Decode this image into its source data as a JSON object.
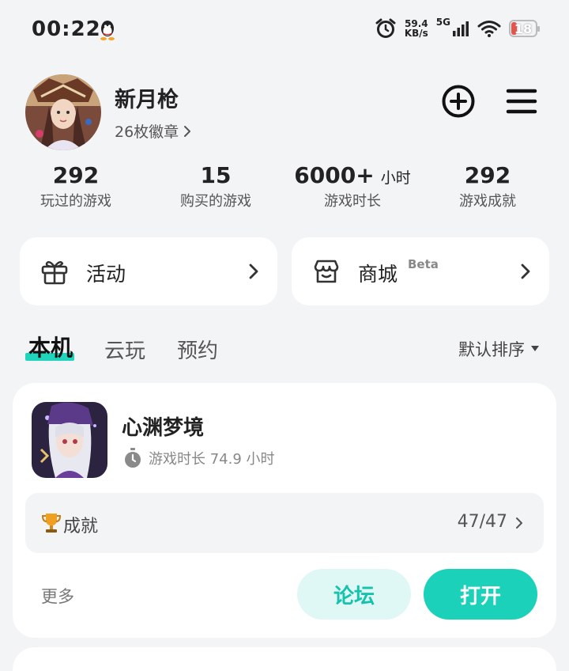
{
  "status_bar": {
    "time": "00:22",
    "net_speed_value": "59.4",
    "net_speed_unit": "KB/s",
    "network_type": "5G",
    "battery_level": "18",
    "icons": [
      "qq-icon",
      "alarm-clock-icon",
      "signal-icon",
      "wifi-icon",
      "battery-icon"
    ]
  },
  "profile": {
    "username": "新月枪",
    "badges_label": "26枚徽章",
    "actions": [
      "add-circle-icon",
      "menu-icon"
    ]
  },
  "stats": [
    {
      "value": "292",
      "unit": "",
      "label": "玩过的游戏"
    },
    {
      "value": "15",
      "unit": "",
      "label": "购买的游戏"
    },
    {
      "value": "6000+",
      "unit": "小时",
      "label": "游戏时长"
    },
    {
      "value": "292",
      "unit": "",
      "label": "游戏成就"
    }
  ],
  "quick_links": {
    "activity": {
      "label": "活动",
      "icon": "gift-icon"
    },
    "store": {
      "label": "商城",
      "tag": "Beta",
      "icon": "store-icon"
    }
  },
  "tabs": {
    "items": [
      "本机",
      "云玩",
      "预约"
    ],
    "active_index": 0,
    "sort_label": "默认排序"
  },
  "game": {
    "title": "心渊梦境",
    "playtime": "游戏时长 74.9 小时",
    "achievements_label": "成就",
    "achievements_count": "47/47",
    "more_label": "更多",
    "forum_label": "论坛",
    "open_label": "打开"
  },
  "colors": {
    "accent": "#1cd1b9",
    "accent_light": "#e0f8f5",
    "background": "#f3f4f6",
    "battery_low": "#e5534b"
  }
}
